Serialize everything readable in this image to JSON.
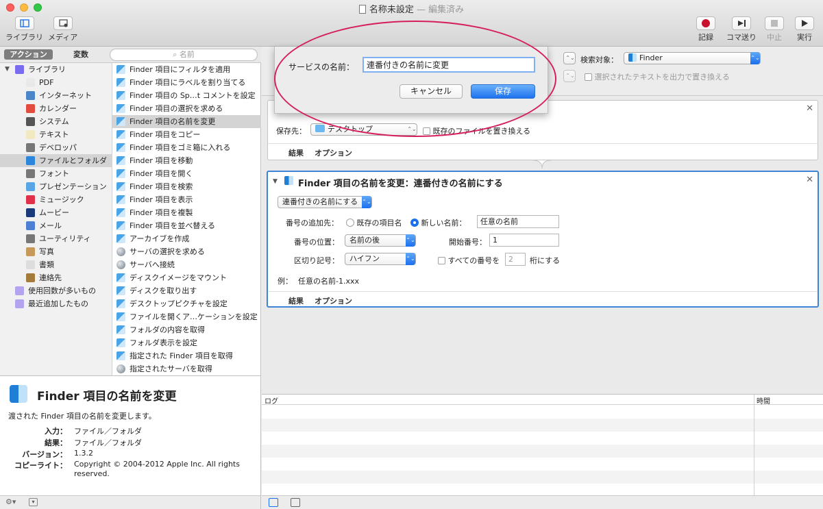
{
  "window": {
    "title": "名称未設定",
    "edited": "— 編集済み"
  },
  "toolbar": {
    "library": "ライブラリ",
    "media": "メディア",
    "record": "記録",
    "step": "コマ送り",
    "stop": "中止",
    "run": "実行"
  },
  "left_header": {
    "actions_tab": "アクション",
    "variables_tab": "変数",
    "search_placeholder": "名前"
  },
  "library": [
    {
      "label": "ライブラリ",
      "icon": "library-icon"
    },
    {
      "label": "PDF",
      "icon": "pdf-icon"
    },
    {
      "label": "インターネット",
      "icon": "internet-icon"
    },
    {
      "label": "カレンダー",
      "icon": "calendar-icon"
    },
    {
      "label": "システム",
      "icon": "system-icon"
    },
    {
      "label": "テキスト",
      "icon": "text-icon"
    },
    {
      "label": "デベロッパ",
      "icon": "developer-icon"
    },
    {
      "label": "ファイルとフォルダ",
      "icon": "finder-icon"
    },
    {
      "label": "フォント",
      "icon": "font-icon"
    },
    {
      "label": "プレゼンテーション",
      "icon": "presentation-icon"
    },
    {
      "label": "ミュージック",
      "icon": "music-icon"
    },
    {
      "label": "ムービー",
      "icon": "movie-icon"
    },
    {
      "label": "メール",
      "icon": "mail-icon"
    },
    {
      "label": "ユーティリティ",
      "icon": "utility-icon"
    },
    {
      "label": "写真",
      "icon": "photo-icon"
    },
    {
      "label": "書類",
      "icon": "document-icon"
    },
    {
      "label": "連絡先",
      "icon": "contacts-icon"
    },
    {
      "label": "使用回数が多いもの",
      "icon": "smart-folder-icon"
    },
    {
      "label": "最近追加したもの",
      "icon": "smart-folder-icon"
    }
  ],
  "actions": [
    "Finder 項目にフィルタを適用",
    "Finder 項目にラベルを割り当てる",
    "Finder 項目の Sp…t コメントを設定",
    "Finder 項目の選択を求める",
    "Finder 項目の名前を変更",
    "Finder 項目をコピー",
    "Finder 項目をゴミ箱に入れる",
    "Finder 項目を移動",
    "Finder 項目を開く",
    "Finder 項目を検索",
    "Finder 項目を表示",
    "Finder 項目を複製",
    "Finder 項目を並べ替える",
    "アーカイブを作成",
    "サーバの選択を求める",
    "サーバへ接続",
    "ディスクイメージをマウント",
    "ディスクを取り出す",
    "デスクトップピクチャを設定",
    "ファイルを開くア…ケーションを設定",
    "フォルダの内容を取得",
    "フォルダ表示を設定",
    "指定された Finder 項目を取得",
    "指定されたサーバを取得"
  ],
  "description": {
    "title": "Finder 項目の名前を変更",
    "subtitle": "渡された Finder 項目の名前を変更します。",
    "input_key": "入力：",
    "input_val": "ファイル／フォルダ",
    "result_key": "結果：",
    "result_val": "ファイル／フォルダ",
    "version_key": "バージョン：",
    "version_val": "1.3.2",
    "copyright_key": "コピーライト：",
    "copyright_val1": "Copyright © 2004-2012 Apple Inc.  All rights",
    "copyright_val2": "reserved."
  },
  "service_bar": {
    "search_target_label": "検索対象：",
    "search_target_value": "Finder",
    "replace_text": "選択されたテキストを出力で置き換える"
  },
  "dialog": {
    "label": "サービスの名前：",
    "value": "連番付きの名前に変更",
    "cancel": "キャンセル",
    "save": "保存"
  },
  "copy_action": {
    "dest_label": "保存先：",
    "dest_value": "デスクトップ",
    "replace_label": "既存のファイルを置き換える",
    "results": "結果",
    "options": "オプション"
  },
  "rename_action": {
    "title": "Finder 項目の名前を変更：連番付きの名前にする",
    "mode": "連番付きの名前にする",
    "add_to_label": "番号の追加先：",
    "radio_existing": "既存の項目名",
    "radio_new": "新しい名前：",
    "new_name": "任意の名前",
    "position_label": "番号の位置：",
    "position_value": "名前の後",
    "start_label": "開始番号：",
    "start_value": "1",
    "separator_label": "区切り記号：",
    "separator_value": "ハイフン",
    "all_numbers_label": "すべての番号を",
    "digits_value": "2",
    "digits_suffix": "桁にする",
    "example_label": "例：",
    "example_value": "任意の名前-1.xxx",
    "results": "結果",
    "options": "オプション"
  },
  "log": {
    "log_header": "ログ",
    "time_header": "時間"
  },
  "colors": {
    "accent": "#1b6ff0",
    "highlight_ellipse": "#d51f5a",
    "selected_row": "#d4d4d4"
  }
}
